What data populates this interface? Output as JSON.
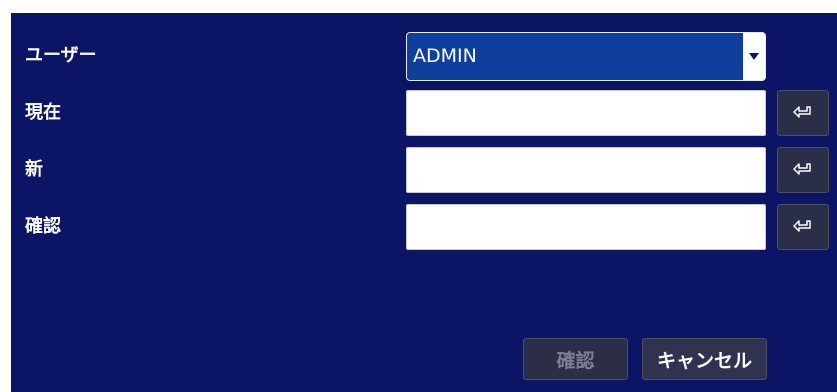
{
  "form": {
    "user_label": "ユーザー",
    "user_value": "ADMIN",
    "current_label": "現在",
    "current_value": "",
    "new_label": "新",
    "new_value": "",
    "confirm_label": "確認",
    "confirm_value": ""
  },
  "icons": {
    "dropdown": "chevron-down-icon",
    "enter": "enter-key-icon"
  },
  "buttons": {
    "confirm_label": "確認",
    "cancel_label": "キャンセル"
  },
  "colors": {
    "background": "#0c1565",
    "select_bg": "#0f3f9c",
    "button_bg": "#2a2e47"
  }
}
